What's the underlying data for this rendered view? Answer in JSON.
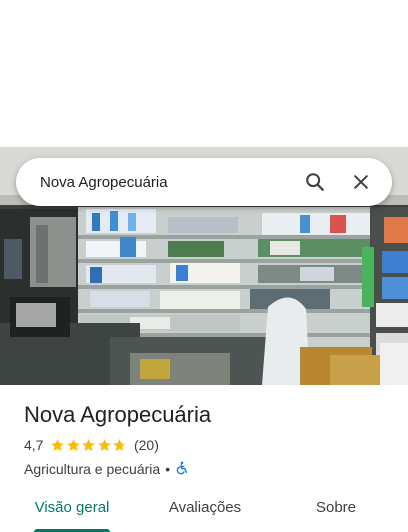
{
  "search": {
    "query": "Nova Agropecuária"
  },
  "place": {
    "name": "Nova Agropecuária",
    "rating": "4,7",
    "stars_value": 4.7,
    "stars_max": 5,
    "review_count": "(20)",
    "category": "Agricultura e pecuária",
    "separator": "•"
  },
  "tabs": [
    {
      "label": "Visão geral",
      "active": true
    },
    {
      "label": "Avaliações",
      "active": false
    },
    {
      "label": "Sobre",
      "active": false
    }
  ],
  "icons": {
    "search": "search-icon",
    "close": "close-icon",
    "star": "star-icon",
    "accessibility": "wheelchair-icon"
  },
  "colors": {
    "accent": "#00796b",
    "star": "#fbbc04",
    "accessibility": "#1a73e8",
    "text_primary": "#202124",
    "text_secondary": "#3c4043"
  }
}
